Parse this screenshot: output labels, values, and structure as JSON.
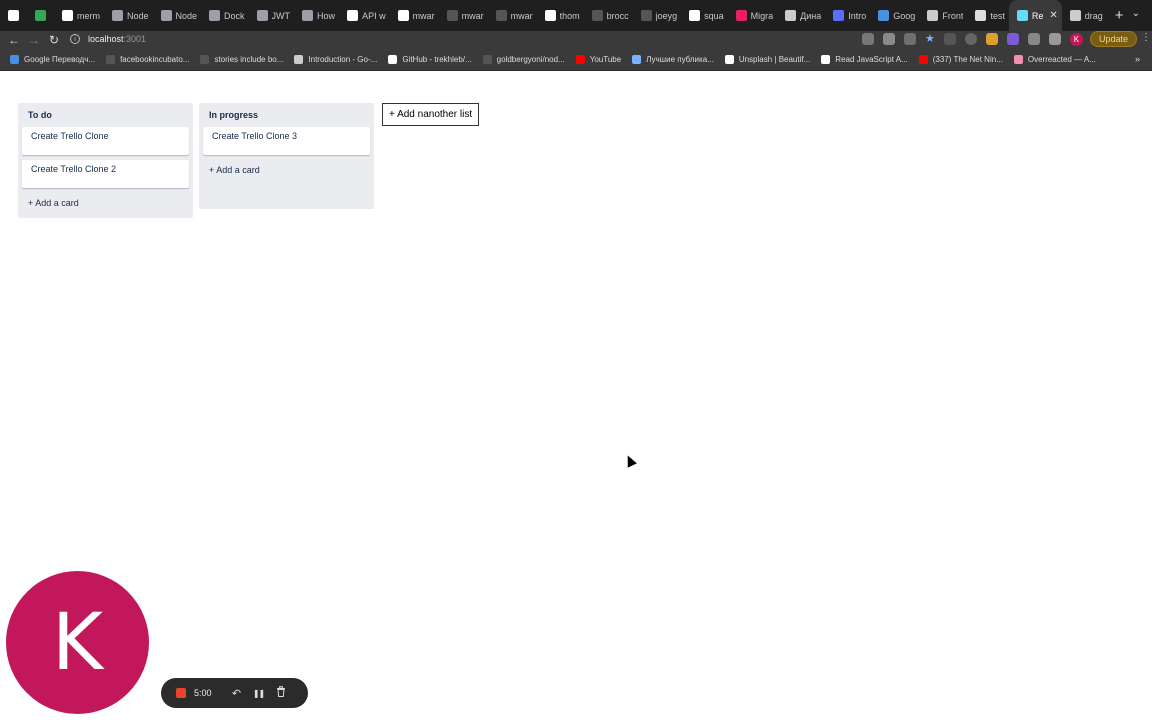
{
  "browser": {
    "tabs": [
      {
        "label": "",
        "color": "#ffffff",
        "icon": "github-icon"
      },
      {
        "label": "",
        "color": "#34a853",
        "icon": "map-pin-icon"
      },
      {
        "label": "merm",
        "color": "#ffffff",
        "icon": "github-icon"
      },
      {
        "label": "Node",
        "color": "#9aa0a6",
        "icon": "page-icon"
      },
      {
        "label": "Node",
        "color": "#9aa0a6",
        "icon": "page-icon"
      },
      {
        "label": "Dock",
        "color": "#9aa0a6",
        "icon": "page-icon"
      },
      {
        "label": "JWT",
        "color": "#9aa0a6",
        "icon": "page-icon"
      },
      {
        "label": "How",
        "color": "#9aa0a6",
        "icon": "page-icon"
      },
      {
        "label": "API w",
        "color": "#ffffff",
        "icon": "email-icon"
      },
      {
        "label": "mwar",
        "color": "#ffffff",
        "icon": "github-icon"
      },
      {
        "label": "mwar",
        "color": "#555555",
        "icon": "page-icon"
      },
      {
        "label": "mwar",
        "color": "#555555",
        "icon": "page-icon"
      },
      {
        "label": "thom",
        "color": "#ffffff",
        "icon": "github-icon"
      },
      {
        "label": "brocc",
        "color": "#555555",
        "icon": "page-icon"
      },
      {
        "label": "joeyg",
        "color": "#555555",
        "icon": "page-icon"
      },
      {
        "label": "squa",
        "color": "#ffffff",
        "icon": "github-icon"
      },
      {
        "label": "Migra",
        "color": "#e91e63",
        "icon": "prisma-icon"
      },
      {
        "label": "Дина",
        "color": "#cccccc",
        "icon": "globe-icon"
      },
      {
        "label": "Intro",
        "color": "#5b6cff",
        "icon": "bridge-icon"
      },
      {
        "label": "Goog",
        "color": "#4a90e2",
        "icon": "translate-icon"
      },
      {
        "label": "Front",
        "color": "#cccccc",
        "icon": "globe-icon"
      },
      {
        "label": "test",
        "color": "#dddddd",
        "icon": "trello-icon"
      },
      {
        "label": "Re",
        "color": "#61dafb",
        "icon": "react-icon",
        "active": true
      },
      {
        "label": "drag",
        "color": "#cccccc",
        "icon": "page-icon"
      }
    ],
    "close_tab_glyph": "✕",
    "new_tab_glyph": "+",
    "tab_menu_glyph": "⌄",
    "url_host": "localhost",
    "url_port": ":3001",
    "update_label": "Update",
    "profile_initial": "K",
    "bookmarks": [
      {
        "label": "Google Переводч...",
        "color": "#4a90e2"
      },
      {
        "label": "facebookincubato...",
        "color": "#555555"
      },
      {
        "label": "stories include bo...",
        "color": "#555555"
      },
      {
        "label": "Introduction - Go-...",
        "color": "#cccccc"
      },
      {
        "label": "GitHub - trekhleb/...",
        "color": "#ffffff"
      },
      {
        "label": "goldbergyoni/nod...",
        "color": "#555555"
      },
      {
        "label": "YouTube",
        "color": "#ff0000"
      },
      {
        "label": "Лучшие публика...",
        "color": "#7ab4ff"
      },
      {
        "label": "Unsplash | Beautif...",
        "color": "#ffffff"
      },
      {
        "label": "Read JavaScript A...",
        "color": "#ffffff"
      },
      {
        "label": "(337) The Net Nin...",
        "color": "#ff0000"
      },
      {
        "label": "Overreacted — A...",
        "color": "#f48fb1"
      }
    ],
    "bookmarks_more": "»"
  },
  "board": {
    "lists": [
      {
        "title": "To do",
        "cards": [
          "Create Trello Clone",
          "Create Trello Clone 2"
        ],
        "add_card_label": "+ Add a card"
      },
      {
        "title": "In progress",
        "cards": [
          "Create Trello Clone 3"
        ],
        "add_card_label": "+ Add a card"
      }
    ],
    "add_list_label": "+ Add nanother list"
  },
  "recorder": {
    "avatar_initial": "K",
    "avatar_color": "#c2185b",
    "time": "5:00",
    "stop_color": "#e8452c",
    "controls": [
      {
        "name": "undo-icon",
        "glyph": "↶"
      },
      {
        "name": "pause-icon",
        "glyph": "❚❚"
      },
      {
        "name": "trash-icon",
        "glyph": "🗑"
      }
    ]
  }
}
